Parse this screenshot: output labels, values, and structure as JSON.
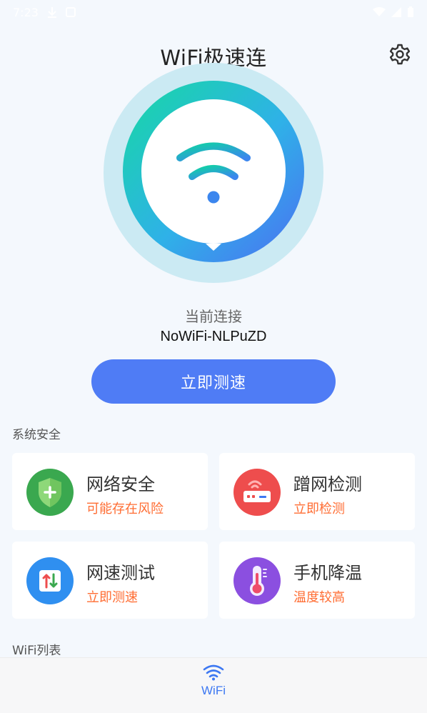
{
  "status_bar": {
    "time": "7:23"
  },
  "header": {
    "title": "WiFi极速连"
  },
  "connection": {
    "label": "当前连接",
    "ssid": "NoWiFi-NLPuZD"
  },
  "speed_button": {
    "label": "立即测速"
  },
  "system_security": {
    "title": "系统安全",
    "cards": [
      {
        "title": "网络安全",
        "subtitle": "可能存在风险",
        "icon": "shield-icon",
        "color": "#3aa84f"
      },
      {
        "title": "蹭网检测",
        "subtitle": "立即检测",
        "icon": "router-icon",
        "color": "#ee4d4d"
      },
      {
        "title": "网速测试",
        "subtitle": "立即测速",
        "icon": "speed-test-icon",
        "color": "#2f8ff0"
      },
      {
        "title": "手机降温",
        "subtitle": "温度较高",
        "icon": "thermometer-icon",
        "color": "#8b4fe0"
      }
    ]
  },
  "wifi_list": {
    "title": "WiFi列表"
  },
  "bottom_nav": {
    "items": [
      {
        "label": "WiFi",
        "icon": "wifi-icon"
      }
    ]
  },
  "colors": {
    "accent": "#4f7cf5",
    "warning_text": "#ff6d33",
    "background": "#f4f8fd"
  }
}
